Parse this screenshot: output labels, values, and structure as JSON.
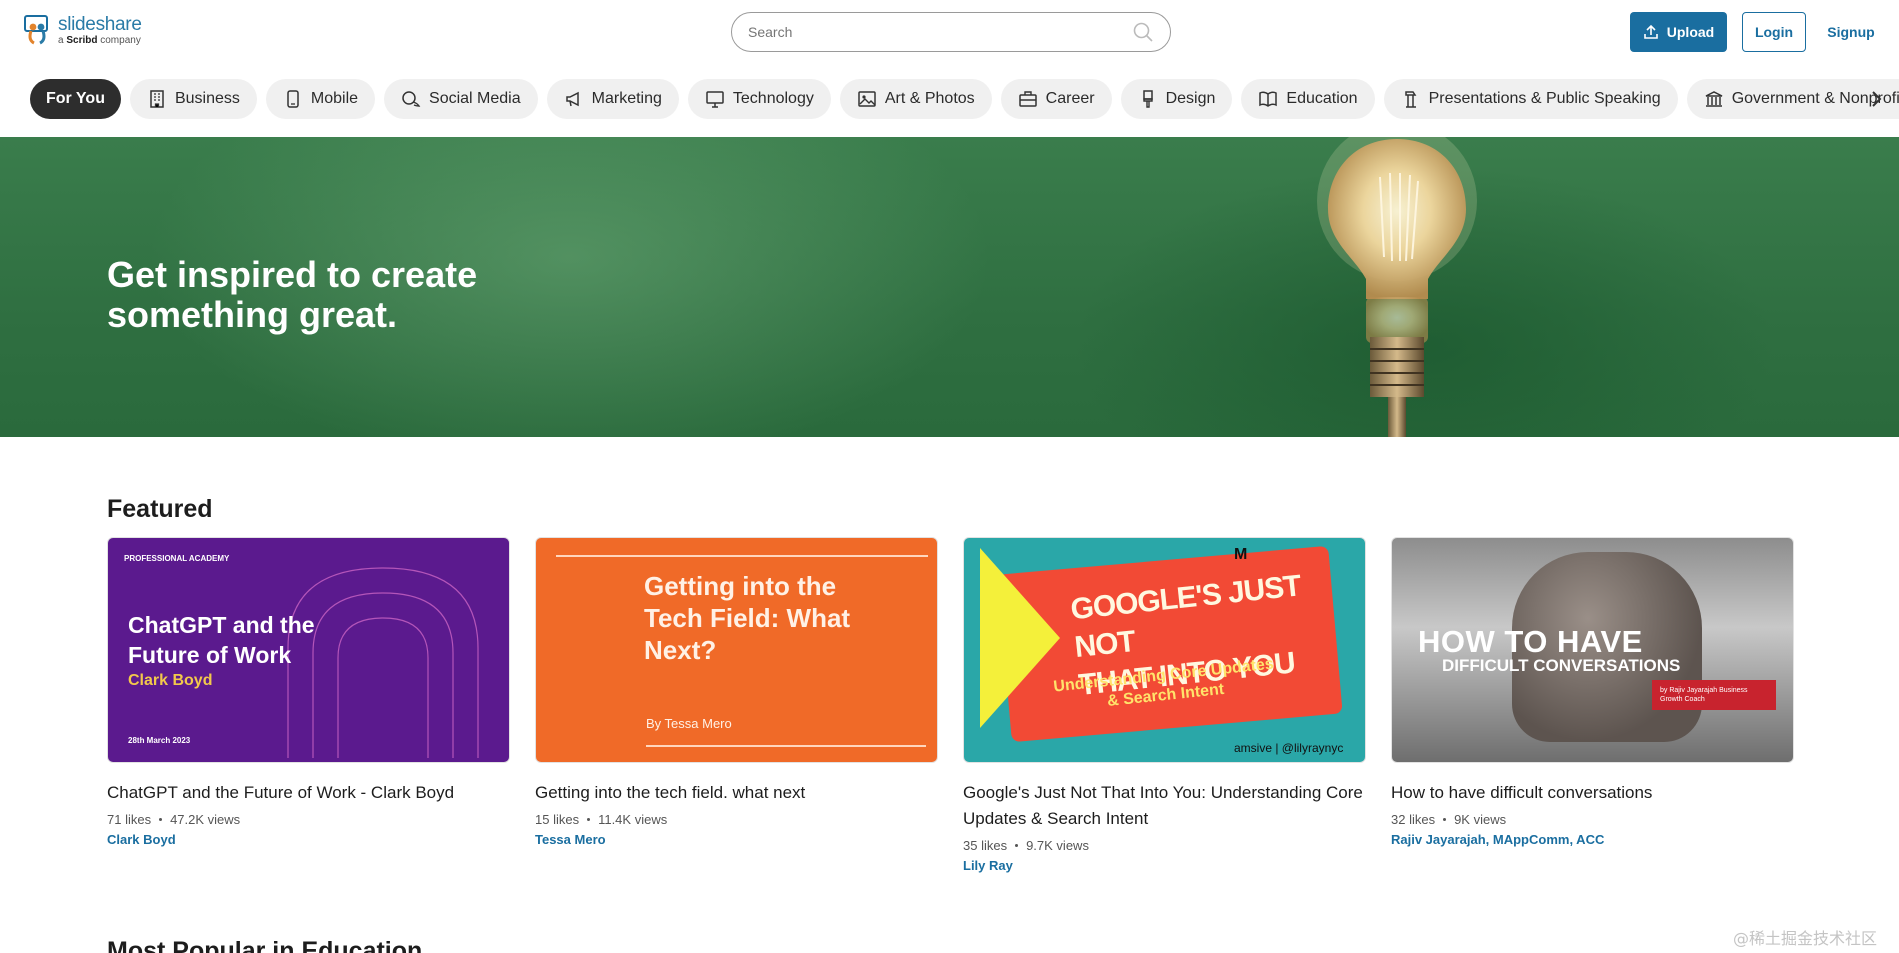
{
  "header": {
    "logo": {
      "name": "slideshare",
      "sub_prefix": "a",
      "sub_brand": "Scribd",
      "sub_suffix": "company"
    },
    "search": {
      "placeholder": "Search"
    },
    "upload_label": "Upload",
    "login_label": "Login",
    "signup_label": "Signup"
  },
  "categories": [
    {
      "label": "For You",
      "icon": "none",
      "active": true
    },
    {
      "label": "Business",
      "icon": "building-icon"
    },
    {
      "label": "Mobile",
      "icon": "phone-icon"
    },
    {
      "label": "Social Media",
      "icon": "chat-bubbles-icon"
    },
    {
      "label": "Marketing",
      "icon": "megaphone-icon"
    },
    {
      "label": "Technology",
      "icon": "monitor-icon"
    },
    {
      "label": "Art & Photos",
      "icon": "image-icon"
    },
    {
      "label": "Career",
      "icon": "briefcase-icon"
    },
    {
      "label": "Design",
      "icon": "brush-icon"
    },
    {
      "label": "Education",
      "icon": "book-icon"
    },
    {
      "label": "Presentations & Public Speaking",
      "icon": "podium-icon"
    },
    {
      "label": "Government & Nonprofit",
      "icon": "government-icon"
    }
  ],
  "hero": {
    "title": "Get inspired to create something great."
  },
  "featured": {
    "title": "Featured",
    "cards": [
      {
        "title": "ChatGPT and the Future of Work - Clark Boyd",
        "likes": "71 likes",
        "views": "47.2K views",
        "author": "Clark Boyd",
        "thumb": {
          "org": "PROFESSIONAL ACADEMY",
          "line1": "ChatGPT and the",
          "line2": "Future of Work",
          "sub": "Clark Boyd",
          "date": "28th March 2023"
        }
      },
      {
        "title": "Getting into the tech field. what next",
        "likes": "15 likes",
        "views": "11.4K views",
        "author": "Tessa Mero",
        "thumb": {
          "line1": "Getting into the",
          "line2": "Tech Field: What",
          "line3": "Next?",
          "sub": "By Tessa Mero"
        }
      },
      {
        "title": "Google's Just Not That Into You: Understanding Core Updates & Search Intent",
        "likes": "35 likes",
        "views": "9.7K views",
        "author": "Lily Ray",
        "thumb": {
          "line1": "GOOGLE'S JUST NOT",
          "line2": "THAT INTO YOU",
          "sub1": "Understanding Core Updates",
          "sub2": "& Search Intent",
          "brand": "M",
          "foot": "amsive | @lilyraynyc"
        }
      },
      {
        "title": "How to have difficult conversations",
        "likes": "32 likes",
        "views": "9K views",
        "author": "Rajiv Jayarajah, MAppComm, ACC",
        "thumb": {
          "line1": "HOW TO HAVE",
          "line2": "DIFFICULT CONVERSATIONS",
          "tag": "by Rajiv Jayarajah Business Growth Coach"
        }
      }
    ]
  },
  "next_section": {
    "title": "Most Popular in Education"
  },
  "watermark": "@稀土掘金技术社区",
  "colors": {
    "brand_blue": "#1a6ea0",
    "chip_bg": "#f0f0f0",
    "chip_active_bg": "#2d2d2d",
    "hero_green": "#2f6f41"
  }
}
